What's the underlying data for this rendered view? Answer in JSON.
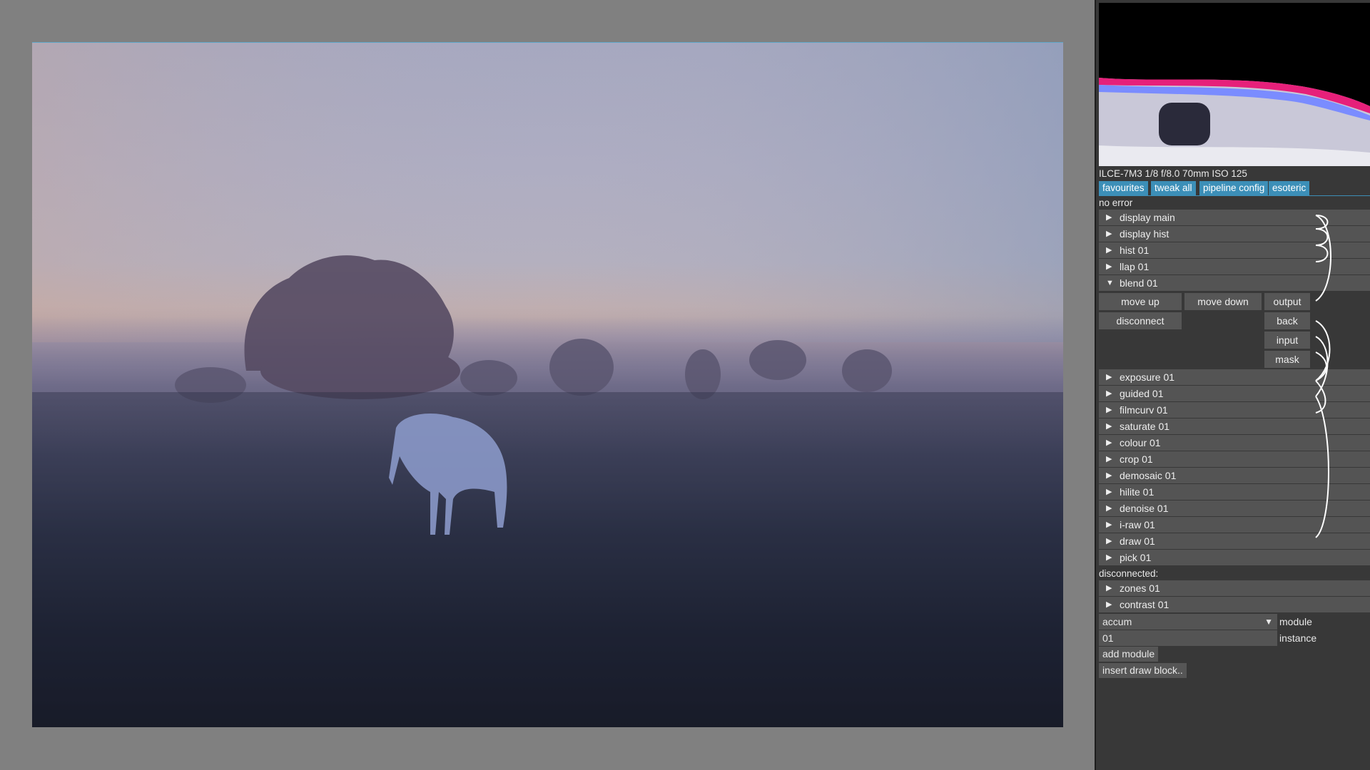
{
  "photo_metadata": "ILCE-7M3 1/8 f/8.0 70mm ISO 125",
  "tabs": [
    "favourites",
    "tweak all",
    "pipeline config",
    "esoteric"
  ],
  "status": "no error",
  "modules": [
    {
      "label": "display main",
      "expanded": false
    },
    {
      "label": "display hist",
      "expanded": false
    },
    {
      "label": "hist 01",
      "expanded": false
    },
    {
      "label": "llap 01",
      "expanded": false
    },
    {
      "label": "blend 01",
      "expanded": true
    }
  ],
  "blend_controls": {
    "move_up": "move up",
    "move_down": "move down",
    "disconnect": "disconnect",
    "connectors": [
      "output",
      "back",
      "input",
      "mask"
    ]
  },
  "modules_after": [
    {
      "label": "exposure 01"
    },
    {
      "label": "guided 01"
    },
    {
      "label": "filmcurv 01"
    },
    {
      "label": "saturate 01"
    },
    {
      "label": "colour 01"
    },
    {
      "label": "crop 01"
    },
    {
      "label": "demosaic 01"
    },
    {
      "label": "hilite 01"
    },
    {
      "label": "denoise 01"
    },
    {
      "label": "i-raw 01"
    },
    {
      "label": "draw 01"
    },
    {
      "label": "pick 01"
    }
  ],
  "disconnected_label": "disconnected:",
  "disconnected_modules": [
    {
      "label": "zones 01"
    },
    {
      "label": "contrast 01"
    }
  ],
  "add_module": {
    "module_value": "accum",
    "module_label": "module",
    "instance_value": "01",
    "instance_label": "instance",
    "add_button": "add module",
    "insert_button": "insert draw block.."
  },
  "icons": {
    "collapsed": "triangle-right",
    "expanded": "triangle-down",
    "dropdown": "triangle-down"
  },
  "colors": {
    "tab_accent": "#3c8fb8",
    "panel_bg": "#383838",
    "row_bg": "#545454",
    "viewport_bg": "#808080"
  }
}
